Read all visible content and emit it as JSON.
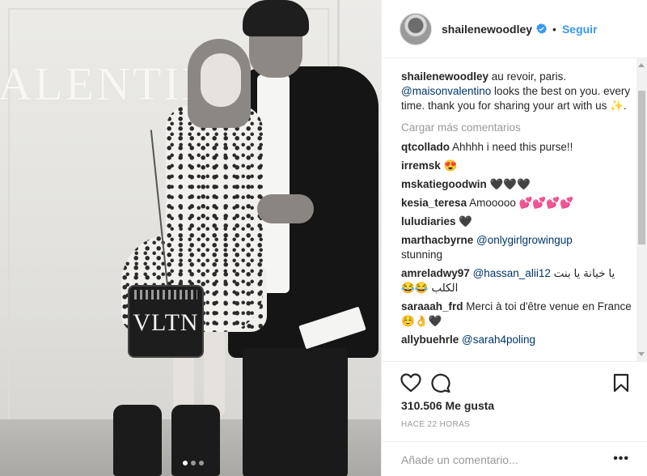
{
  "photo": {
    "wall_text": "VALENTINO",
    "bag_logo": "VLTN",
    "carousel": {
      "count": 3,
      "active": 1
    }
  },
  "header": {
    "avatar": "profile-avatar",
    "username": "shailenewoodley",
    "verified": true,
    "separator": "•",
    "follow_label": "Seguir",
    "follow_color": "#3897f0"
  },
  "caption": {
    "username": "shailenewoodley",
    "text_before": " au revoir, paris.",
    "mention": "@maisonvalentino",
    "text_after": " looks the best on you. every time. thank you for sharing your art with us ✨."
  },
  "load_more": "Cargar más comentarios",
  "comments": [
    {
      "user": "qtcollado",
      "text": " Ahhhh i need this purse!!"
    },
    {
      "user": "irremsk",
      "text": " 😍"
    },
    {
      "user": "mskatiegoodwin",
      "text": " 🖤🖤🖤"
    },
    {
      "user": "kesia_teresa",
      "text": " Amooooo 💕💕💕💕"
    },
    {
      "user": "luludiaries",
      "text": " 🖤"
    },
    {
      "user": "marthacbyrne",
      "mention": " @onlygirlgrowingup",
      "text": " stunning"
    },
    {
      "user": "amreladwy97",
      "mention": " @hassan_alii12",
      "text": " يا خيانة يا بنت الكلب 😂😂"
    },
    {
      "user": "saraaah_frd",
      "text": " Merci à toi d'être venue en France☺️👌🖤"
    },
    {
      "user": "allybuehrle",
      "mention": " @sarah4poling",
      "text": ""
    }
  ],
  "actions": {
    "like_icon": "heart-icon",
    "comment_icon": "comment-icon",
    "save_icon": "bookmark-icon",
    "likes": "310.506 Me gusta",
    "timestamp": "HACE 22 HORAS"
  },
  "add_comment": {
    "placeholder": "Añade un comentario...",
    "more_label": "•••"
  }
}
